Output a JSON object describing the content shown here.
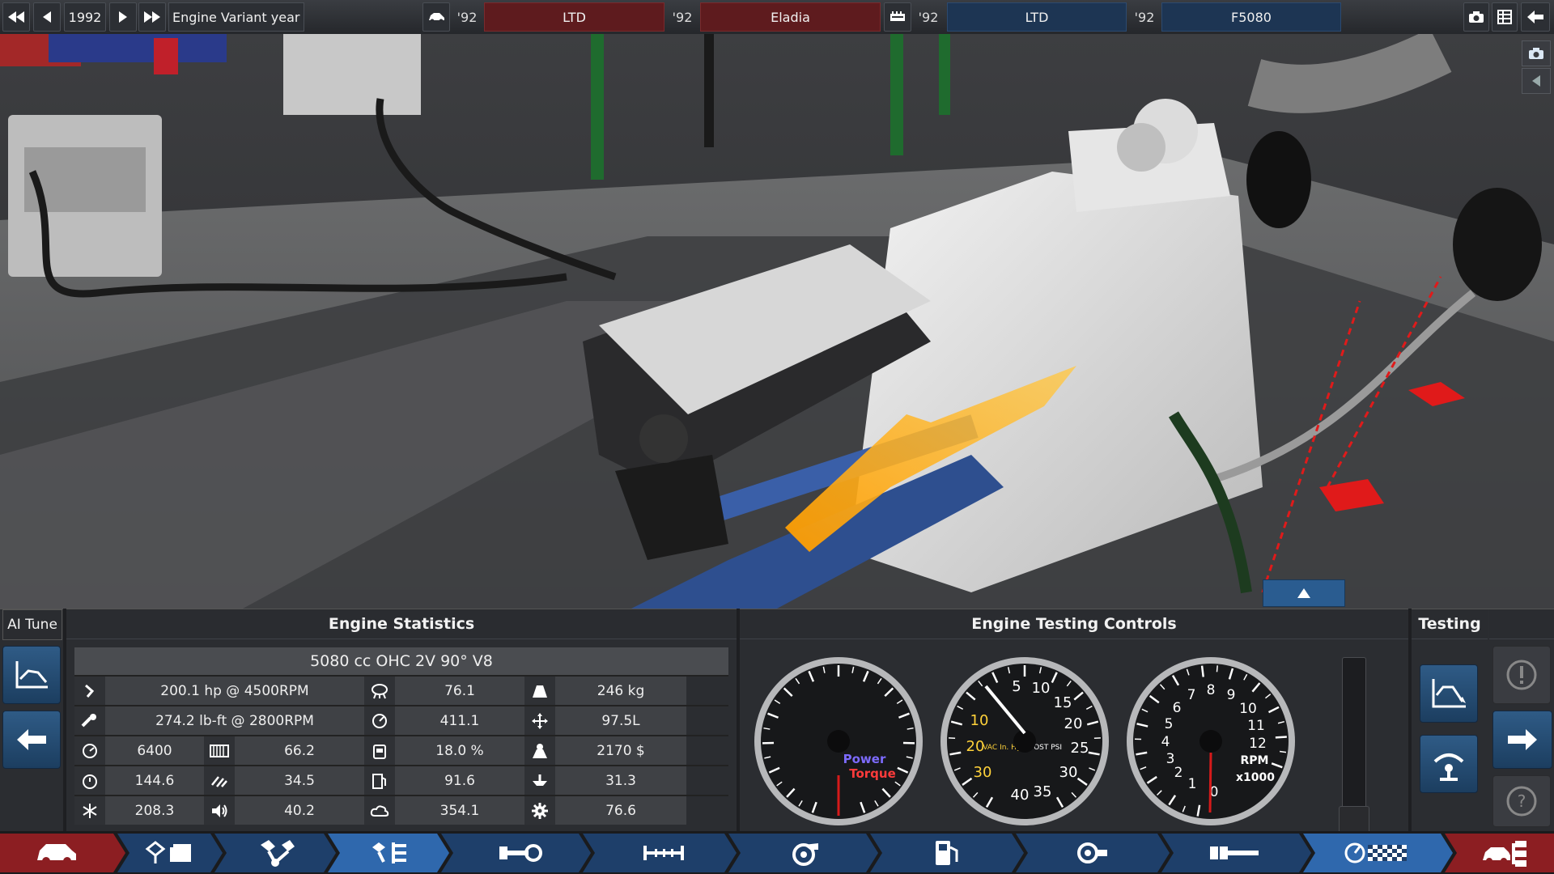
{
  "topbar": {
    "year": "1992",
    "variant_label": "Engine Variant year",
    "car_year_1": "'92",
    "car_trim": "LTD",
    "car_year_2": "'92",
    "car_model": "Eladia",
    "engine_year_1": "'92",
    "engine_family": "LTD",
    "engine_year_2": "'92",
    "engine_variant": "F5080"
  },
  "panel": {
    "ai_tune_label": "AI Tune",
    "stats_title": "Engine Statistics",
    "testing_controls_title": "Engine Testing Controls",
    "testing_title": "Testing"
  },
  "stats": {
    "engine_desc": "5080 cc OHC 2V 90° V8",
    "rows": [
      {
        "icon1": "power-icon",
        "v1": "200.1 hp @ 4500RPM",
        "icon2": "emissions-icon",
        "v2": "76.1",
        "icon3": "weight-icon",
        "v3": "246 kg"
      },
      {
        "icon1": "torque-icon",
        "v1": "274.2 lb-ft @ 2800RPM",
        "icon2": "fuel-economy-icon",
        "v2": "411.1",
        "icon3": "size-icon",
        "v3": "97.5L"
      },
      {
        "icon1": "redline-icon",
        "v1": "6400",
        "icon2": "radiator-icon",
        "v2": "66.2",
        "icon3": "fuel-tank-icon",
        "v3": "18.0 %",
        "icon4": "cost-icon",
        "v4": "2170 $"
      },
      {
        "icon1": "timer-icon",
        "v1": "144.6",
        "icon2": "smoothness-icon",
        "v2": "34.5",
        "icon3": "pump-icon",
        "v3": "91.6",
        "icon4": "service-icon",
        "v4": "31.3"
      },
      {
        "icon1": "cooling-icon",
        "v1": "208.3",
        "icon2": "sound-icon",
        "v2": "40.2",
        "icon3": "cloud-icon",
        "v3": "354.1",
        "icon4": "reliability-icon",
        "v4": "76.6"
      }
    ]
  },
  "gauges": {
    "power_label": "Power",
    "torque_label": "Torque",
    "boost_labels": [
      "5",
      "10",
      "15",
      "20",
      "25",
      "30",
      "35",
      "40"
    ],
    "vac_labels": [
      "10",
      "20",
      "30"
    ],
    "vac_unit": "VAC In. Hg",
    "boost_unit": "BOOST PSI",
    "rpm_labels": [
      "0",
      "1",
      "2",
      "3",
      "4",
      "5",
      "6",
      "7",
      "8",
      "9",
      "10",
      "11",
      "12"
    ],
    "rpm_unit": "RPM",
    "rpm_mult": "x1000"
  },
  "colors": {
    "accent_blue": "#2d5a86",
    "dropdown_red": "#5e1b1e",
    "dropdown_blue": "#1d3553",
    "power_text": "#7d6bff",
    "torque_text": "#ff3b3b",
    "vac_text": "#ffd23a"
  },
  "bottom_nav": [
    {
      "name": "car-body-tab",
      "icon": "car-icon"
    },
    {
      "name": "engine-family-tab",
      "icon": "engine-block-icon"
    },
    {
      "name": "engine-bottom-end-tab",
      "icon": "pistons-icon"
    },
    {
      "name": "engine-top-end-tab",
      "icon": "valvetrain-icon"
    },
    {
      "name": "aspiration-tab",
      "icon": "camshaft-icon"
    },
    {
      "name": "intake-tab",
      "icon": "manifold-icon"
    },
    {
      "name": "turbo-tab",
      "icon": "turbo-icon"
    },
    {
      "name": "fuel-tab",
      "icon": "fuel-pump-icon"
    },
    {
      "name": "ignition-tab",
      "icon": "sensor-icon"
    },
    {
      "name": "exhaust-tab",
      "icon": "exhaust-icon"
    },
    {
      "name": "testing-tab",
      "icon": "dyno-icon"
    },
    {
      "name": "car-engine-tree-tab",
      "icon": "car-tree-icon"
    }
  ]
}
